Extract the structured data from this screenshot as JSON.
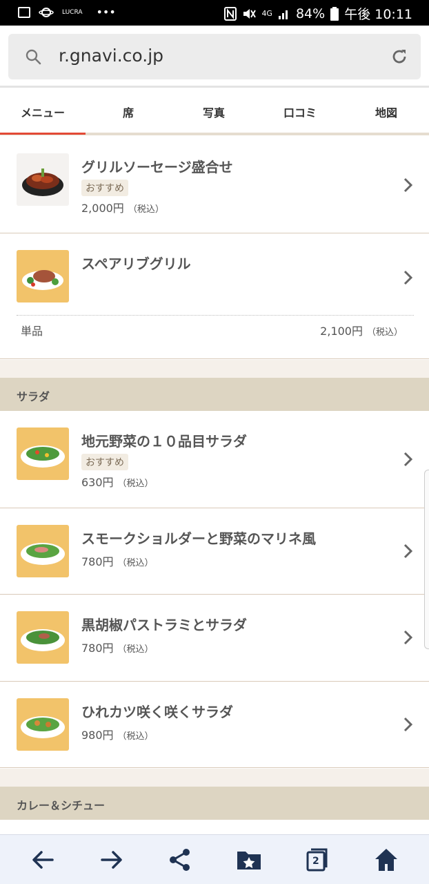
{
  "status_bar": {
    "carrier_label": "LUCRA",
    "dots": "•••",
    "signal_label": "4G",
    "battery": "84%",
    "time": "午後 10:11"
  },
  "browser": {
    "url": "r.gnavi.co.jp",
    "tab_count": "2"
  },
  "tabs": [
    {
      "label": "メニュー",
      "active": true
    },
    {
      "label": "席"
    },
    {
      "label": "写真"
    },
    {
      "label": "口コミ"
    },
    {
      "label": "地図"
    }
  ],
  "menu": {
    "items": [
      {
        "name": "グリルソーセージ盛合せ",
        "badge": "おすすめ",
        "price": "2,000円",
        "tax": "（税込）"
      },
      {
        "name": "スペアリブグリル",
        "variant_label": "単品",
        "variant_price": "2,100円",
        "variant_tax": "（税込）"
      }
    ],
    "sections": [
      {
        "title": "サラダ",
        "items": [
          {
            "name": "地元野菜の１０品目サラダ",
            "badge": "おすすめ",
            "price": "630円",
            "tax": "（税込）"
          },
          {
            "name": "スモークショルダーと野菜のマリネ風",
            "price": "780円",
            "tax": "（税込）"
          },
          {
            "name": "黒胡椒パストラミとサラダ",
            "price": "780円",
            "tax": "（税込）"
          },
          {
            "name": "ひれカツ咲く咲くサラダ",
            "price": "980円",
            "tax": "（税込）"
          }
        ]
      },
      {
        "title": "カレー＆シチュー",
        "items": []
      }
    ]
  },
  "colors": {
    "accent_red": "#e34a36",
    "section_bg": "#ddd5c2",
    "badge_bg": "#f2ece2",
    "nav_icon": "#1f3353"
  },
  "icons": {
    "search": "search-icon",
    "reload": "reload-icon",
    "back": "arrow-left-icon",
    "forward": "arrow-right-icon",
    "share": "share-icon",
    "bookmarks": "bookmark-folder-icon",
    "tabs": "tabs-icon",
    "home": "home-icon"
  }
}
